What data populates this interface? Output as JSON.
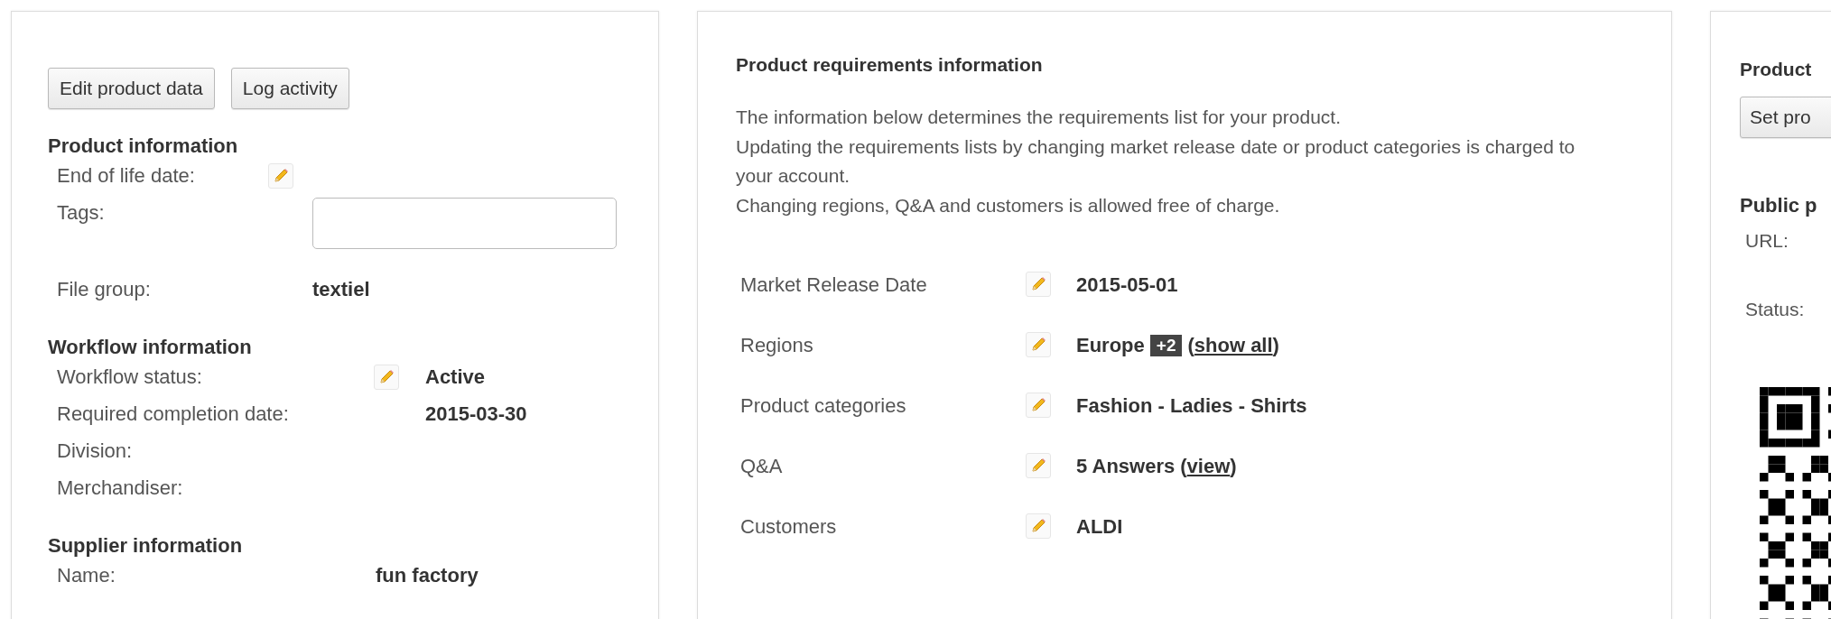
{
  "product_panel": {
    "buttons": [
      "Edit product data",
      "Log activity"
    ],
    "sections": [
      {
        "title": "Product information",
        "rows": [
          {
            "label": "End of life date:",
            "kind": "edit"
          },
          {
            "label": "Tags:",
            "kind": "field"
          },
          {
            "label": "File group:",
            "kind": "text",
            "value": "textiel"
          }
        ]
      },
      {
        "title": "Workflow information",
        "rows": [
          {
            "label": "Workflow status:",
            "kind": "edit",
            "value": "Active"
          },
          {
            "label": "Required completion date:",
            "kind": "text",
            "value": "2015-03-30"
          },
          {
            "label": "Division:",
            "kind": "text"
          },
          {
            "label": "Merchandiser:",
            "kind": "text"
          }
        ]
      },
      {
        "title": "Supplier information",
        "rows": [
          {
            "label": "Name:",
            "kind": "text",
            "value": "fun factory"
          }
        ]
      }
    ]
  },
  "requirements_panel": {
    "title": "Product requirements information",
    "description": [
      "The information below determines the requirements list for your product.",
      "Updating the requirements lists by changing market release date or product categories is charged to your account.",
      "Changing regions, Q&A and customers is allowed free of charge."
    ],
    "rows": [
      {
        "label": "Market Release Date",
        "parts": [
          {
            "kind": "text",
            "text": "2015-05-01"
          }
        ]
      },
      {
        "label": "Regions",
        "parts": [
          {
            "kind": "text",
            "text": "Europe"
          },
          {
            "kind": "badge",
            "text": "+2"
          },
          {
            "kind": "text",
            "text": "("
          },
          {
            "kind": "link",
            "text": "show all"
          },
          {
            "kind": "text",
            "text": ")"
          }
        ]
      },
      {
        "label": "Product categories",
        "parts": [
          {
            "kind": "text",
            "text": "Fashion - Ladies - Shirts"
          }
        ]
      },
      {
        "label": "Q&A",
        "parts": [
          {
            "kind": "text",
            "text": "5 Answers"
          },
          {
            "kind": "text",
            "text": "("
          },
          {
            "kind": "link",
            "text": "view"
          },
          {
            "kind": "text",
            "text": ")"
          }
        ]
      },
      {
        "label": "Customers",
        "parts": [
          {
            "kind": "text",
            "text": "ALDI"
          }
        ]
      }
    ]
  },
  "public_panel": {
    "title": "Product",
    "button": "Set pro",
    "section_title": "Public p",
    "rows": [
      {
        "label": "URL:"
      },
      {
        "label": "Status:"
      }
    ]
  }
}
